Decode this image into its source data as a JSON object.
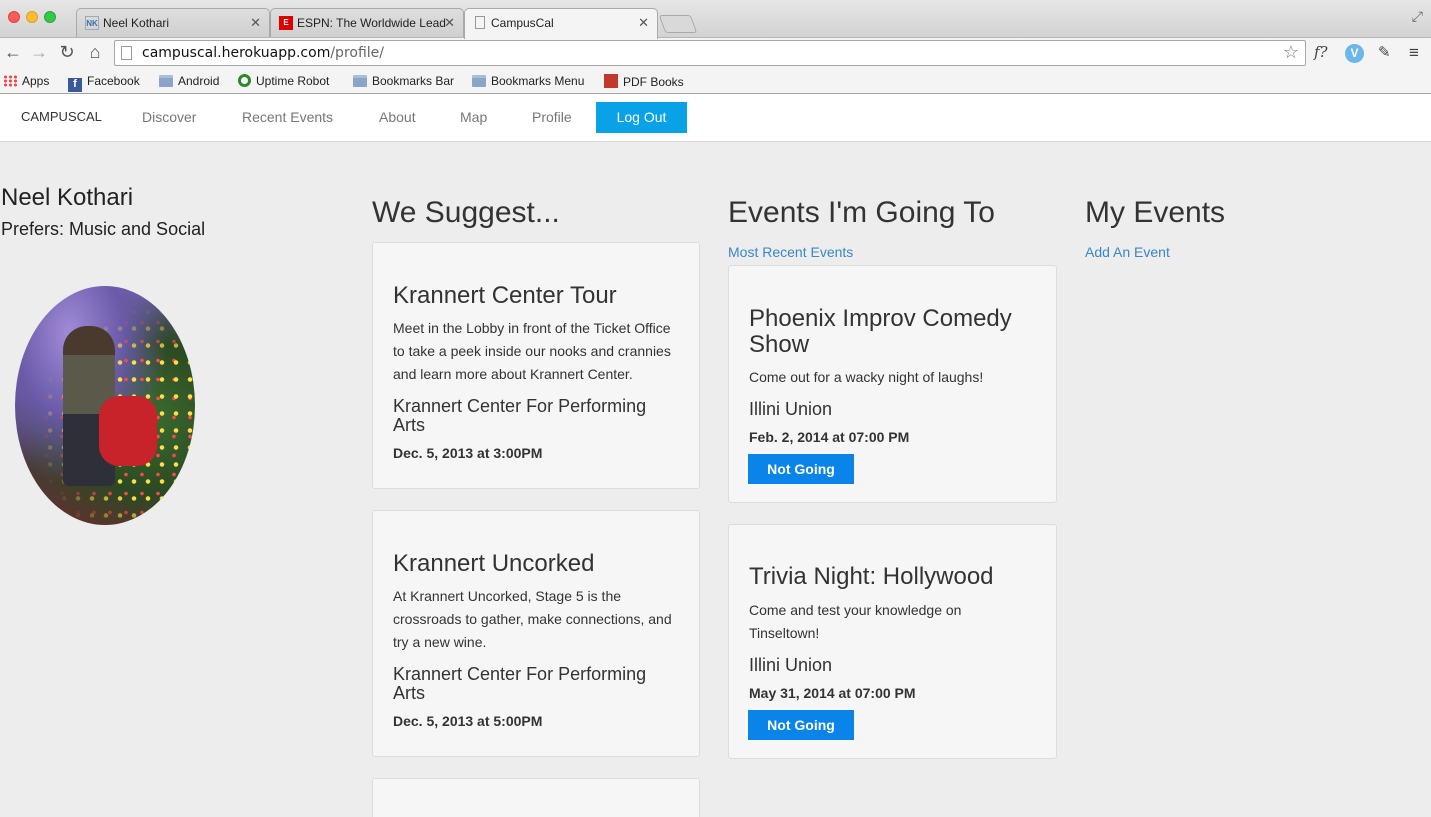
{
  "browser": {
    "tabs": [
      {
        "title": "Neel Kothari",
        "favicon": "NK"
      },
      {
        "title": "ESPN: The Worldwide Lead",
        "favicon": "E"
      },
      {
        "title": "CampusCal",
        "favicon": ""
      }
    ],
    "url_host": "campuscal.herokuapp.com",
    "url_path": "/profile/",
    "bookmarks": [
      "Apps",
      "Facebook",
      "Android",
      "Uptime Robot",
      "Bookmarks Bar",
      "Bookmarks Menu",
      "PDF Books"
    ],
    "extensions": {
      "f_label": "f?",
      "v_label": "V"
    }
  },
  "nav": {
    "brand": "CAMPUSCAL",
    "links": [
      "Discover",
      "Recent Events",
      "About",
      "Map",
      "Profile"
    ],
    "logout": "Log Out",
    "accent": "#0aa2e6"
  },
  "profile": {
    "name": "Neel Kothari",
    "prefs": "Prefers: Music and Social"
  },
  "suggest": {
    "heading": "We Suggest...",
    "cards": [
      {
        "title": "Krannert Center Tour",
        "desc": [
          "Meet in the Lobby in front of the Ticket Office",
          "to take a peek inside our nooks and crannies",
          "and learn more about Krannert Center."
        ],
        "venue": [
          "Krannert Center For Performing",
          "Arts"
        ],
        "when": "Dec. 5, 2013 at 3:00PM"
      },
      {
        "title": "Krannert Uncorked",
        "desc": [
          "At Krannert Uncorked, Stage 5 is the",
          "crossroads to gather, make connections, and",
          "try a new wine."
        ],
        "venue": [
          "Krannert Center For Performing",
          "Arts"
        ],
        "when": "Dec. 5, 2013 at 5:00PM"
      }
    ]
  },
  "going": {
    "heading": "Events I'm Going To",
    "link": "Most Recent Events",
    "button": "Not Going",
    "button_color": "#0a84e8",
    "cards": [
      {
        "title": [
          "Phoenix Improv Comedy",
          "Show"
        ],
        "desc": [
          "Come out for a wacky night of laughs!"
        ],
        "venue": "Illini Union",
        "when": "Feb. 2, 2014 at 07:00 PM"
      },
      {
        "title": [
          "Trivia Night: Hollywood"
        ],
        "desc": [
          "Come and test your knowledge on",
          "Tinseltown!"
        ],
        "venue": "Illini Union",
        "when": "May 31, 2014 at 07:00 PM"
      }
    ]
  },
  "mine": {
    "heading": "My Events",
    "link": "Add An Event"
  }
}
